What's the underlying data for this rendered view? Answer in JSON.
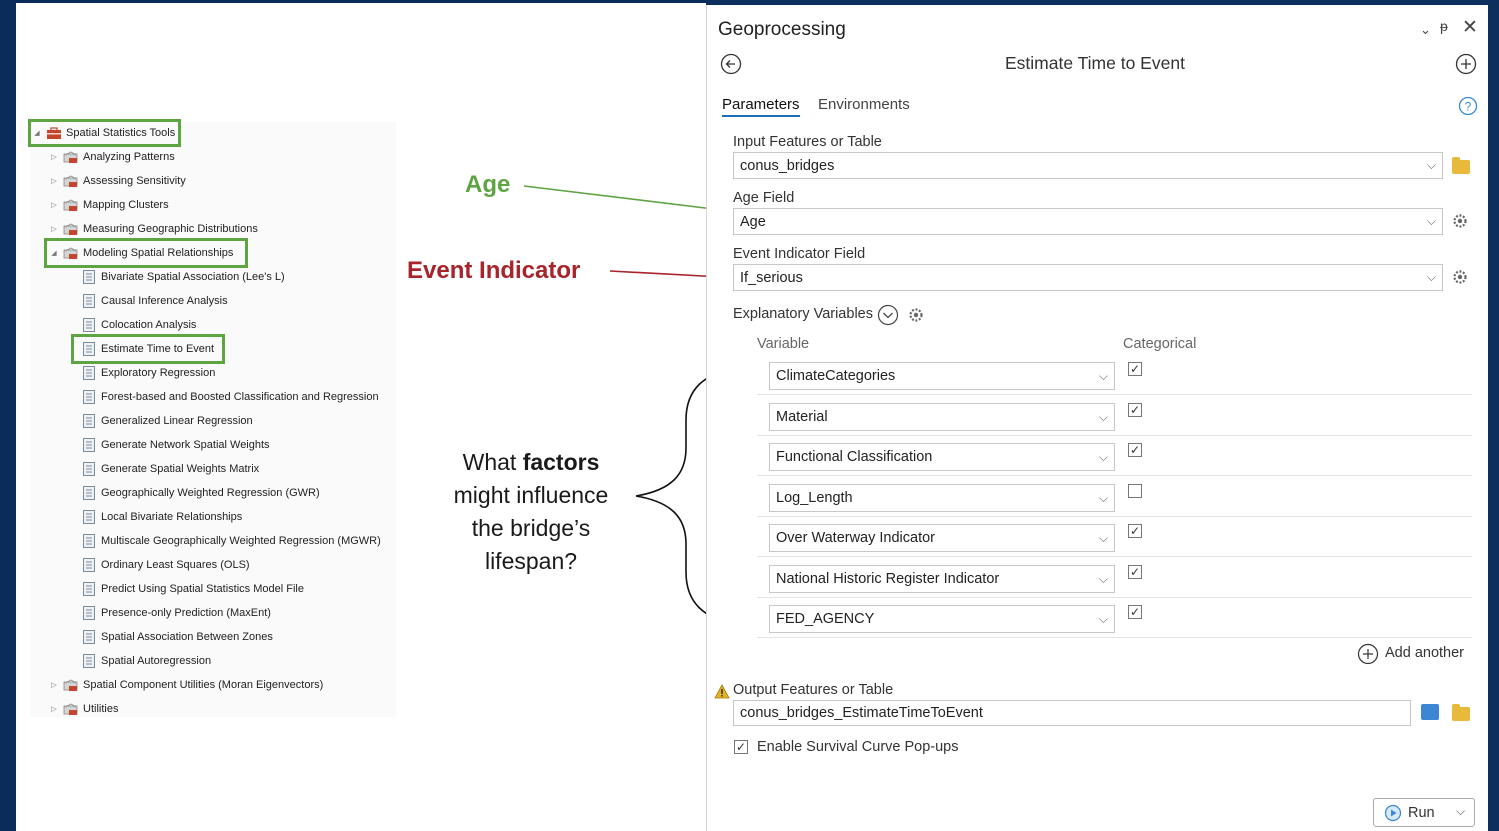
{
  "tree": {
    "root": "Spatial Statistics Tools",
    "toolsets_before": [
      "Analyzing Patterns",
      "Assessing Sensitivity",
      "Mapping Clusters",
      "Measuring Geographic Distributions"
    ],
    "open_toolset": "Modeling Spatial Relationships",
    "tools": [
      "Bivariate Spatial Association (Lee's L)",
      "Causal Inference Analysis",
      "Colocation Analysis",
      "Estimate Time to Event",
      "Exploratory Regression",
      "Forest-based and Boosted Classification and Regression",
      "Generalized Linear Regression",
      "Generate Network Spatial Weights",
      "Generate Spatial Weights Matrix",
      "Geographically Weighted Regression (GWR)",
      "Local Bivariate Relationships",
      "Multiscale Geographically Weighted Regression (MGWR)",
      "Ordinary Least Squares (OLS)",
      "Predict Using Spatial Statistics Model File",
      "Presence-only Prediction (MaxEnt)",
      "Spatial Association Between Zones",
      "Spatial Autoregression"
    ],
    "toolsets_after": [
      "Spatial Component Utilities (Moran Eigenvectors)",
      "Utilities"
    ]
  },
  "annotations": {
    "age": "Age",
    "event": "Event Indicator",
    "question_1": "What ",
    "question_bold": "factors",
    "question_2": "might influence",
    "question_3": "the bridge’s",
    "question_4": "lifespan?"
  },
  "colors": {
    "highlight": "#5ea443",
    "age": "#5ea443",
    "event": "#a8232a",
    "background": "#0c2f5e"
  },
  "panel": {
    "title": "Geoprocessing",
    "tool_title": "Estimate Time to Event",
    "tabs": [
      "Parameters",
      "Environments"
    ],
    "input_label": "Input Features or Table",
    "input_value": "conus_bridges",
    "age_label": "Age Field",
    "age_value": "Age",
    "event_label": "Event Indicator Field",
    "event_value": "If_serious",
    "explanatory_label": "Explanatory Variables",
    "col_variable": "Variable",
    "col_categorical": "Categorical",
    "variables": [
      {
        "name": "ClimateCategories",
        "categorical": true
      },
      {
        "name": "Material",
        "categorical": true
      },
      {
        "name": "Functional Classification",
        "categorical": true
      },
      {
        "name": "Log_Length",
        "categorical": false
      },
      {
        "name": "Over Waterway Indicator",
        "categorical": true
      },
      {
        "name": "National Historic Register Indicator",
        "categorical": true
      },
      {
        "name": "FED_AGENCY",
        "categorical": true
      }
    ],
    "add_another": "Add another",
    "output_label": "Output Features or Table",
    "output_value": "conus_bridges_EstimateTimeToEvent",
    "popups_label": "Enable Survival Curve Pop-ups",
    "popups_checked": true,
    "run_label": "Run"
  }
}
